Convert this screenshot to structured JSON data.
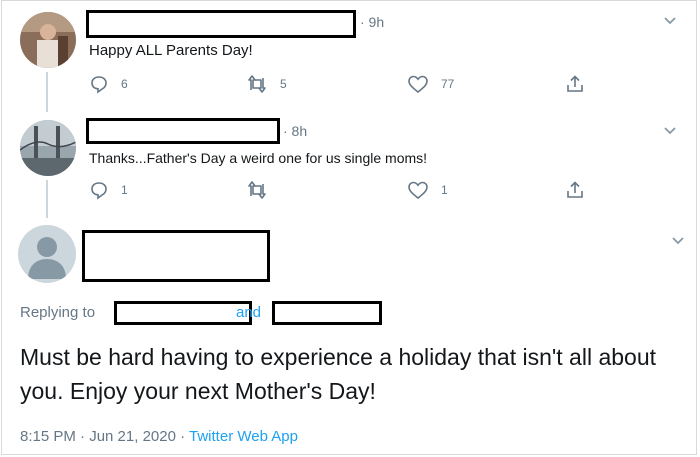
{
  "tweet1": {
    "time": "· 9h",
    "text": "Happy ALL Parents Day!",
    "replies": "6",
    "retweets": "5",
    "likes": "77"
  },
  "tweet2": {
    "time": "· 8h",
    "text": "Thanks...Father's Day a weird one for us single moms!",
    "replies": "1",
    "retweets": "",
    "likes": "1"
  },
  "tweet3": {
    "replying_prefix": "Replying to",
    "and_label": "and",
    "text": "Must be hard having to experience a holiday that isn't all about you. Enjoy your next Mother's Day!",
    "date": "8:15 PM · Jun 21, 2020 ·",
    "source": "Twitter Web App"
  },
  "icons": [
    "chevron-down-icon",
    "reply-icon",
    "retweet-icon",
    "like-icon",
    "share-icon",
    "default-avatar-icon"
  ],
  "colors": {
    "link": "#1da1f2",
    "meta": "#657786",
    "icon": "#657786"
  }
}
